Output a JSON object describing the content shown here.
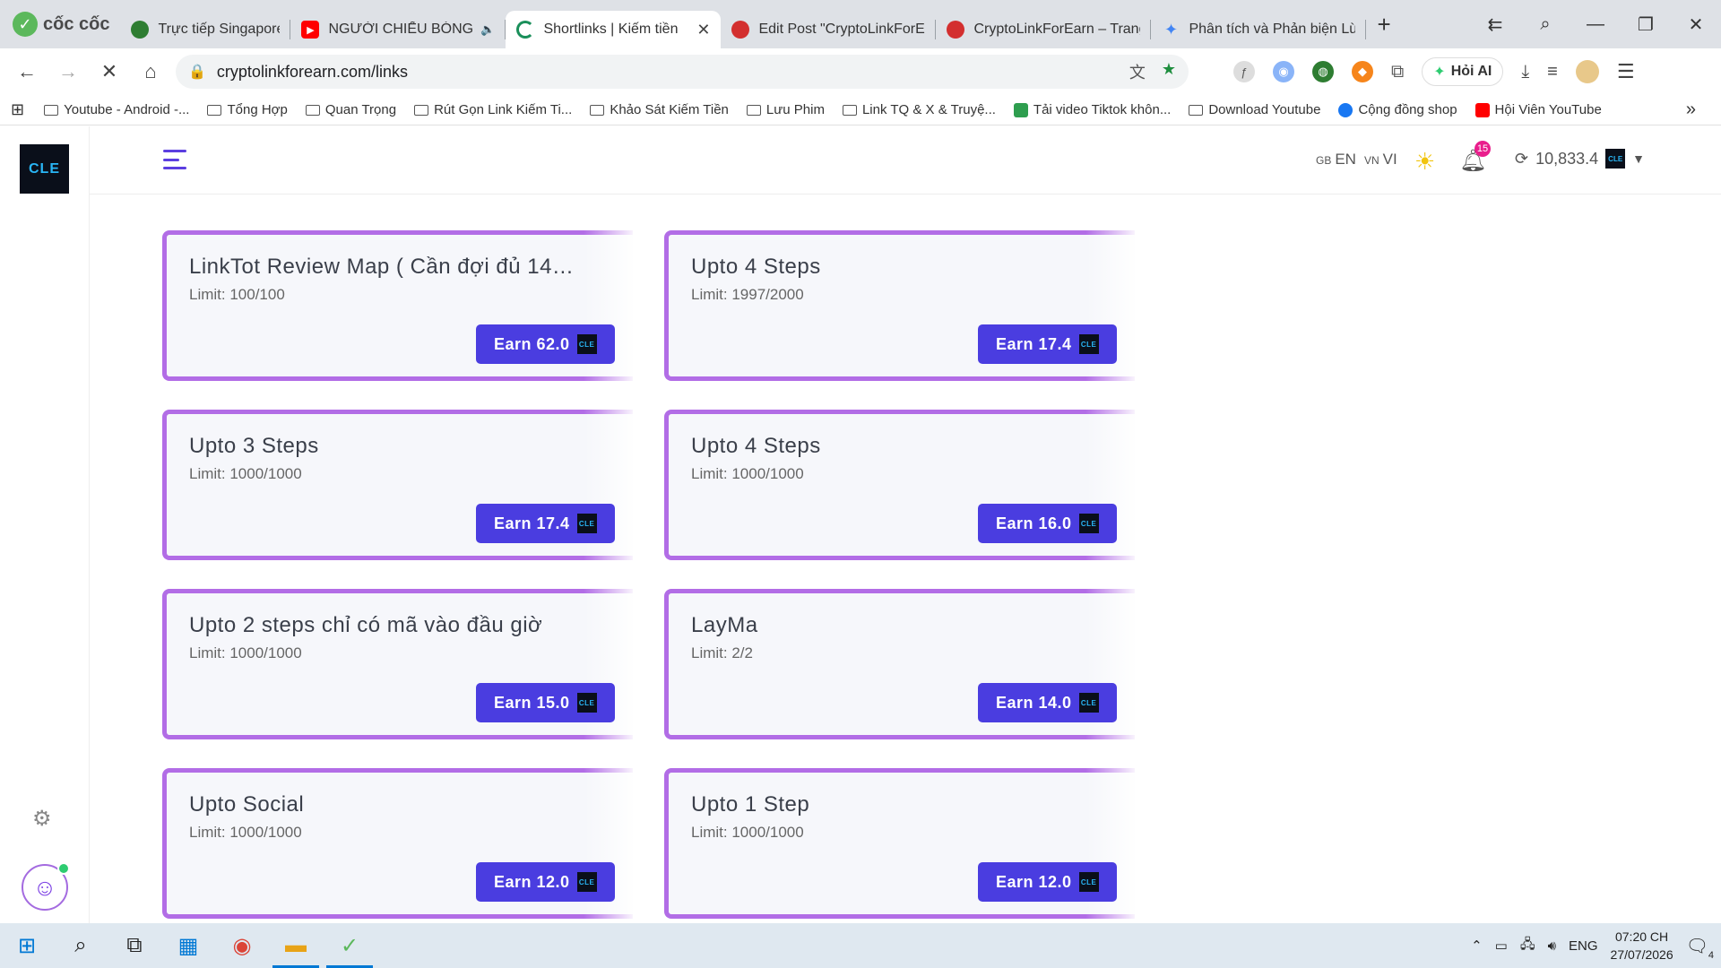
{
  "browser": {
    "brand": "cốc cốc",
    "tabs": [
      {
        "title": "Trực tiếp Singapore vs Tim",
        "color": "#2e7d32",
        "icon": "globe-icon"
      },
      {
        "title": "NGƯỜI CHIẾU BÓNG E",
        "color": "#ff0000",
        "icon": "youtube-icon"
      },
      {
        "title": "Shortlinks | Kiếm tiền",
        "color": "#1a8f5a",
        "icon": "loading-icon",
        "active": true
      },
      {
        "title": "Edit Post \"CryptoLinkForEa",
        "color": "#d32f2f",
        "icon": "site-icon"
      },
      {
        "title": "CryptoLinkForEarn – Trang",
        "color": "#d32f2f",
        "icon": "site-icon"
      },
      {
        "title": "Phân tích và Phản biện Lừ",
        "color": "#4285f4",
        "icon": "gemini-icon"
      }
    ],
    "url": "cryptolinkforearn.com/links",
    "hoi_ai": "Hỏi AI",
    "bookmarks": [
      {
        "label": "Youtube - Android -...",
        "type": "folder"
      },
      {
        "label": "Tổng Hợp",
        "type": "folder"
      },
      {
        "label": "Quan Trọng",
        "type": "folder"
      },
      {
        "label": "Rút Gọn Link Kiếm Ti...",
        "type": "folder"
      },
      {
        "label": "Khảo Sát Kiếm Tiền",
        "type": "folder"
      },
      {
        "label": "Lưu Phim",
        "type": "folder"
      },
      {
        "label": "Link TQ & X & Truyệ...",
        "type": "folder"
      },
      {
        "label": "Tải video Tiktok khôn...",
        "type": "site",
        "color": "#2e9e4f"
      },
      {
        "label": "Download Youtube",
        "type": "folder"
      },
      {
        "label": "Cộng đồng shop",
        "type": "site",
        "color": "#1877f2"
      },
      {
        "label": "Hội Viên YouTube",
        "type": "site",
        "color": "#ff0000"
      }
    ]
  },
  "site": {
    "logo": "CLE",
    "lang_en_flag": "GB",
    "lang_en": "EN",
    "lang_vi_flag": "VN",
    "lang_vi": "VI",
    "notifications": "15",
    "balance": "10,833.4",
    "coin_label": "CLE"
  },
  "cards": [
    {
      "title": "LinkTot Review Map ( Cần đợi đủ 14…",
      "limit": "Limit: 100/100",
      "earn": "Earn  62.0"
    },
    {
      "title": "Upto 4 Steps",
      "limit": "Limit: 1997/2000",
      "earn": "Earn  17.4"
    },
    {
      "title": "Upto 3 Steps",
      "limit": "Limit: 1000/1000",
      "earn": "Earn  17.4"
    },
    {
      "title": "Upto 4 Steps",
      "limit": "Limit: 1000/1000",
      "earn": "Earn  16.0"
    },
    {
      "title": "Upto 2 steps chỉ có mã vào đầu giờ",
      "limit": "Limit: 1000/1000",
      "earn": "Earn  15.0"
    },
    {
      "title": "LayMa",
      "limit": "Limit: 2/2",
      "earn": "Earn  14.0"
    },
    {
      "title": "Upto Social",
      "limit": "Limit: 1000/1000",
      "earn": "Earn  12.0"
    },
    {
      "title": "Upto 1 Step",
      "limit": "Limit: 1000/1000",
      "earn": "Earn  12.0"
    }
  ],
  "taskbar": {
    "lang": "ENG",
    "time": "07:20 CH",
    "date": "27/07/2026",
    "notif_count": "4"
  },
  "colors": {
    "accent": "#4a3de0",
    "card_border": "#b26de6"
  }
}
